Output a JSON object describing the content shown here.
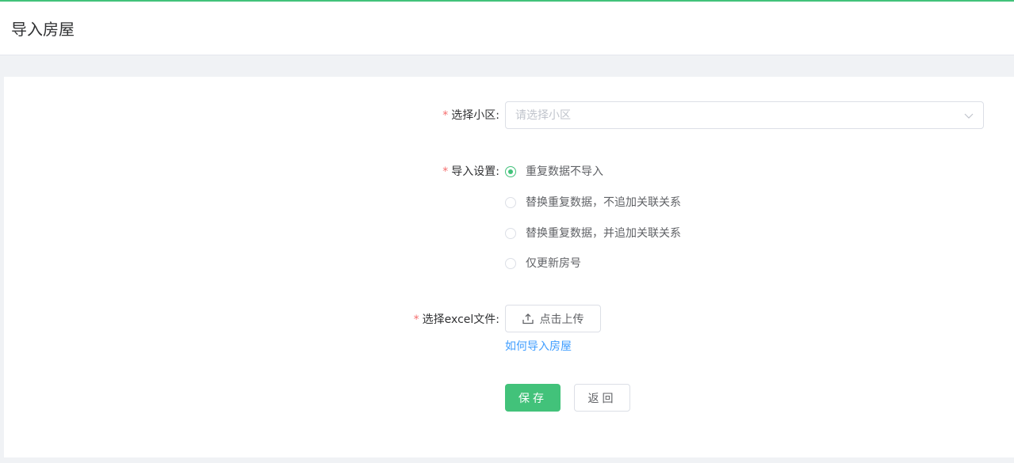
{
  "header": {
    "title": "导入房屋"
  },
  "form": {
    "community": {
      "label": "选择小区:",
      "placeholder": "请选择小区"
    },
    "import_settings": {
      "label": "导入设置:",
      "options": [
        "重复数据不导入",
        "替换重复数据，不追加关联关系",
        "替换重复数据，并追加关联关系",
        "仅更新房号"
      ],
      "selected": "重复数据不导入"
    },
    "excel": {
      "label": "选择excel文件:",
      "upload_label": "点击上传",
      "help_link": "如何导入房屋"
    }
  },
  "actions": {
    "save_label": "保存",
    "back_label": "返回"
  },
  "colors": {
    "primary": "#42c27a",
    "link": "#409eff",
    "required": "#f56c6c"
  },
  "icons": {
    "select": "chevron-down-icon",
    "upload": "upload-icon"
  }
}
